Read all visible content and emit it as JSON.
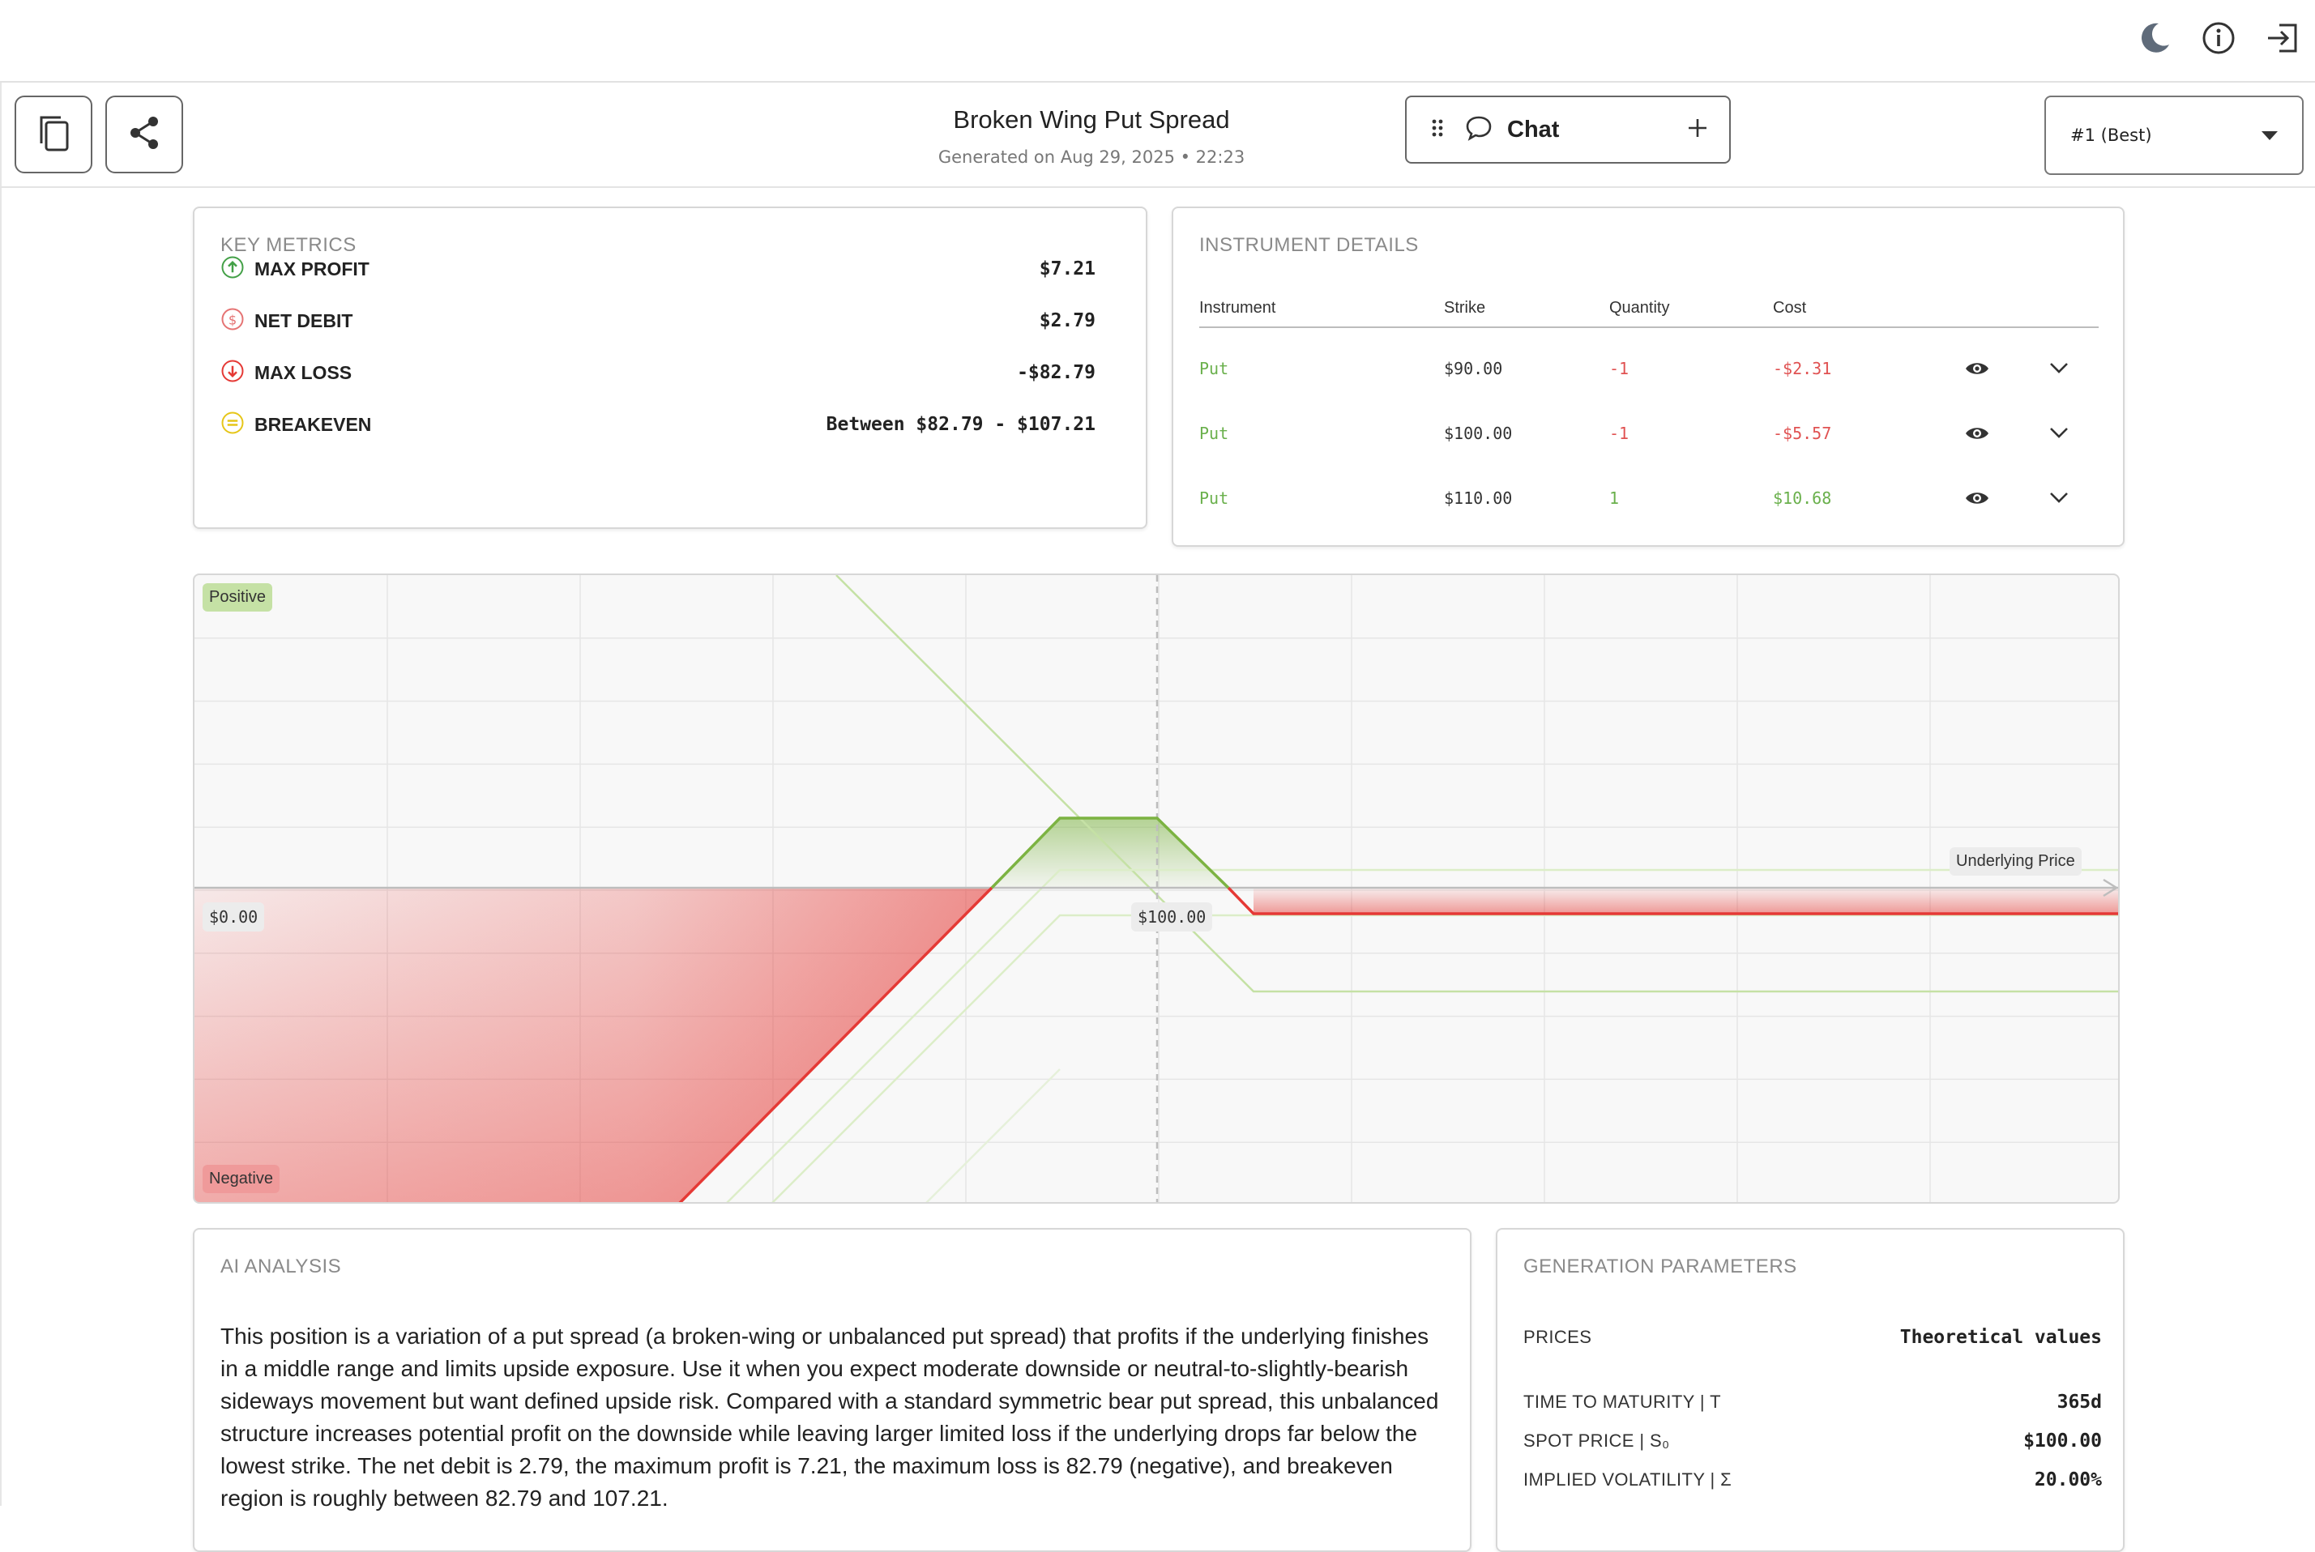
{
  "header": {
    "title": "Broken Wing Put Spread",
    "subtitle": "Generated on Aug 29, 2025 • 22:23",
    "chat_label": "Chat",
    "rank_select": "#1 (Best)"
  },
  "icons": [
    "moon-icon",
    "info-icon",
    "logout-icon",
    "copy-icon",
    "share-icon",
    "drag-handle-icon",
    "chat-bubble-icon",
    "plus-icon",
    "caret-down-icon",
    "eye-icon",
    "chevron-down-icon"
  ],
  "key_metrics": {
    "title": "KEY METRICS",
    "items": [
      {
        "label": "MAX PROFIT",
        "value": "$7.21",
        "color": "#43a047"
      },
      {
        "label": "NET DEBIT",
        "value": "$2.79",
        "color": "#e57373"
      },
      {
        "label": "MAX LOSS",
        "value": "-$82.79",
        "color": "#e53935"
      },
      {
        "label": "BREAKEVEN",
        "value": "Between $82.79 - $107.21",
        "color": "#e6c619"
      }
    ]
  },
  "instrument_details": {
    "title": "INSTRUMENT DETAILS",
    "columns": [
      "Instrument",
      "Strike",
      "Quantity",
      "Cost"
    ],
    "rows": [
      {
        "instrument": "Put",
        "strike": "$90.00",
        "quantity": "-1",
        "cost": "-$2.31"
      },
      {
        "instrument": "Put",
        "strike": "$100.00",
        "quantity": "-1",
        "cost": "-$5.57"
      },
      {
        "instrument": "Put",
        "strike": "$110.00",
        "quantity": "1",
        "cost": "$10.68"
      }
    ]
  },
  "payoff_chart": {
    "positive_label": "Positive",
    "negative_label": "Negative",
    "zero_label": "$0.00",
    "strike_label": "$100.00",
    "x_axis_label": "Underlying Price",
    "colors": {
      "profit": "#7cb342",
      "loss": "#e53935",
      "leg": "#c5e1a5"
    }
  },
  "ai_analysis": {
    "title": "AI ANALYSIS",
    "text": "This position is a variation of a put spread (a broken-wing or unbalanced put spread) that profits if the underlying finishes in a middle range and limits upside exposure. Use it when you expect moderate downside or neutral-to-slightly-bearish sideways movement but want defined upside risk. Compared with a standard symmetric bear put spread, this unbalanced structure increases potential profit on the downside while leaving larger limited loss if the underlying drops far below the lowest strike. The net debit is 2.79, the maximum profit is 7.21, the maximum loss is 82.79 (negative), and breakeven region is roughly between 82.79 and 107.21."
  },
  "generation_parameters": {
    "title": "GENERATION PARAMETERS",
    "prices_label": "PRICES",
    "prices_value": "Theoretical values",
    "params": [
      {
        "label": "TIME TO MATURITY | T",
        "value": "365d"
      },
      {
        "label": "SPOT PRICE | S₀",
        "value": "$100.00"
      },
      {
        "label": "IMPLIED VOLATILITY | Σ",
        "value": "20.00%"
      }
    ]
  }
}
